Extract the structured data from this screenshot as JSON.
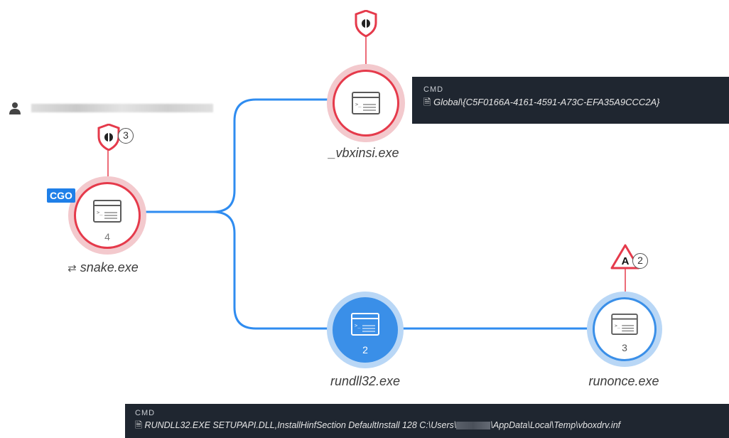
{
  "colors": {
    "edge": "#2f8cf0",
    "alert_red": "#e53a4b",
    "alert_ring": "#f3c9cd",
    "blue_fill": "#3a8fe8",
    "blue_ring": "#b9d7f6",
    "cmd_bg": "#1f2630",
    "tag_blue": "#1f7fe8"
  },
  "user": {
    "icon": "user-icon",
    "name_redacted": ""
  },
  "nodes": {
    "snake": {
      "label": "snake.exe",
      "count": "4",
      "tag": "CGO",
      "detections": "3",
      "prefix_icon": "refresh-icon"
    },
    "vbxinsi": {
      "label": "_vbxinsi.exe",
      "count": ""
    },
    "rundll32": {
      "label": "rundll32.exe",
      "count": "2"
    },
    "runonce": {
      "label": "runonce.exe",
      "count": "3",
      "alerts": "2"
    }
  },
  "cmd_top": {
    "title": "CMD",
    "text": "Global\\{C5F0166A-4161-4591-A73C-EFA35A9CCC2A}"
  },
  "cmd_bottom": {
    "title": "CMD",
    "text_before": "RUNDLL32.EXE SETUPAPI.DLL,InstallHinfSection DefaultInstall 128 C:\\Users\\",
    "text_after": "\\AppData\\Local\\Temp\\vboxdrv.inf"
  },
  "badges": {
    "shield_letter": "",
    "triangle_letter": "A"
  }
}
